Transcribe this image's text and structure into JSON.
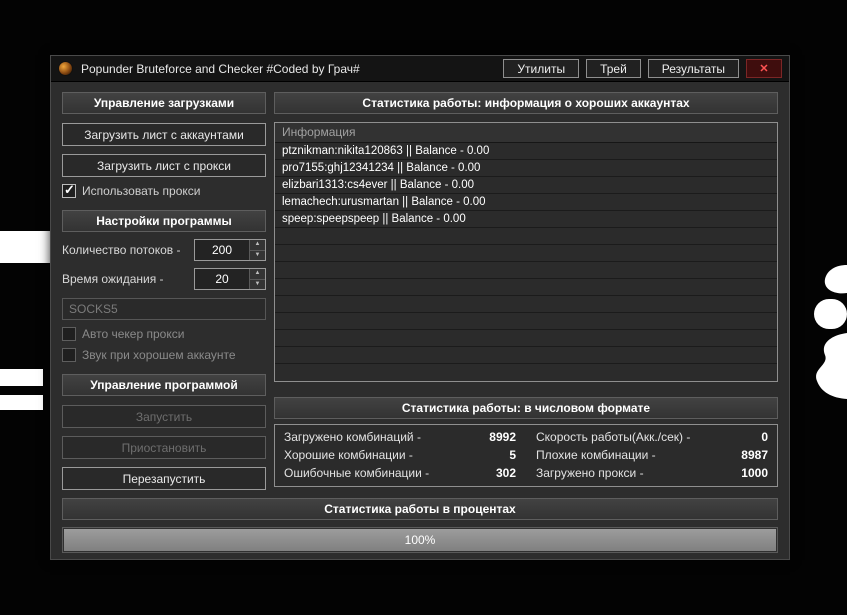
{
  "window": {
    "title": "Popunder Bruteforce and Checker #Coded by Грач#",
    "menu_buttons": [
      "Утилиты",
      "Трей",
      "Результаты"
    ]
  },
  "icons": {
    "close": "✕",
    "check": "✓",
    "spinner_up": "▲",
    "spinner_down": "▼"
  },
  "colors": {
    "close_red": "#ff5353",
    "progress_fill": "#8f8f8f",
    "window_bg": "#2d2d2d"
  },
  "left": {
    "loads": {
      "title": "Управление загрузками",
      "btn_accounts": "Загрузить лист с аккаунтами",
      "btn_proxy": "Загрузить лист с прокси",
      "chk_use_proxy": "Использовать прокси"
    },
    "settings": {
      "title": "Настройки программы",
      "threads_label": "Количество потоков -",
      "threads_value": "200",
      "timeout_label": "Время ожидания -",
      "timeout_value": "20",
      "proxy_type": "SOCKS5",
      "chk_auto_proxy": "Авто чекер прокси",
      "chk_sound": "Звук при хорошем аккаунте"
    },
    "control": {
      "title": "Управление программой",
      "btn_start": "Запустить",
      "btn_pause": "Приостановить",
      "btn_restart": "Перезапустить"
    }
  },
  "right": {
    "accounts": {
      "title": "Статистика работы: информация о хороших аккаунтах",
      "column_header": "Информация",
      "rows": [
        "ptznikman:nikita120863 || Balance - 0.00",
        "pro7155:ghj12341234 || Balance - 0.00",
        "elizbari1313:cs4ever || Balance - 0.00",
        "lemachech:urusmartan || Balance - 0.00",
        "speep:speepspeep || Balance - 0.00"
      ]
    },
    "stats": {
      "title": "Статистика работы: в числовом формате",
      "items": [
        {
          "label": "Загружено комбинаций -",
          "value": "8992"
        },
        {
          "label": "Скорость работы(Акк./сек) -",
          "value": "0"
        },
        {
          "label": "Хорошие комбинации -",
          "value": "5"
        },
        {
          "label": "Плохие комбинации -",
          "value": "8987"
        },
        {
          "label": "Ошибочные комбинации -",
          "value": "302"
        },
        {
          "label": "Загружено прокси -",
          "value": "1000"
        }
      ]
    }
  },
  "progress": {
    "title": "Статистика работы в процентах",
    "percent": 100,
    "label": "100%"
  }
}
